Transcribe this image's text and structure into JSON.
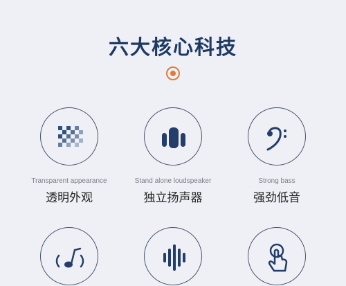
{
  "page_title": "六大核心科技",
  "features": [
    {
      "en": "Transparent appearance",
      "zh": "透明外观",
      "icon": "checker-pattern-icon"
    },
    {
      "en": "Stand alone loudspeaker",
      "zh": "独立扬声器",
      "icon": "speaker-icon"
    },
    {
      "en": "Strong bass",
      "zh": "强劲低音",
      "icon": "bass-clef-icon"
    },
    {
      "icon": "music-note-waves-icon"
    },
    {
      "icon": "sound-wave-icon"
    },
    {
      "icon": "touch-control-icon"
    }
  ],
  "colors": {
    "background": "#eff0f6",
    "title": "#1e3a63",
    "icon": "#233e6a",
    "accent": "#e07b39"
  }
}
